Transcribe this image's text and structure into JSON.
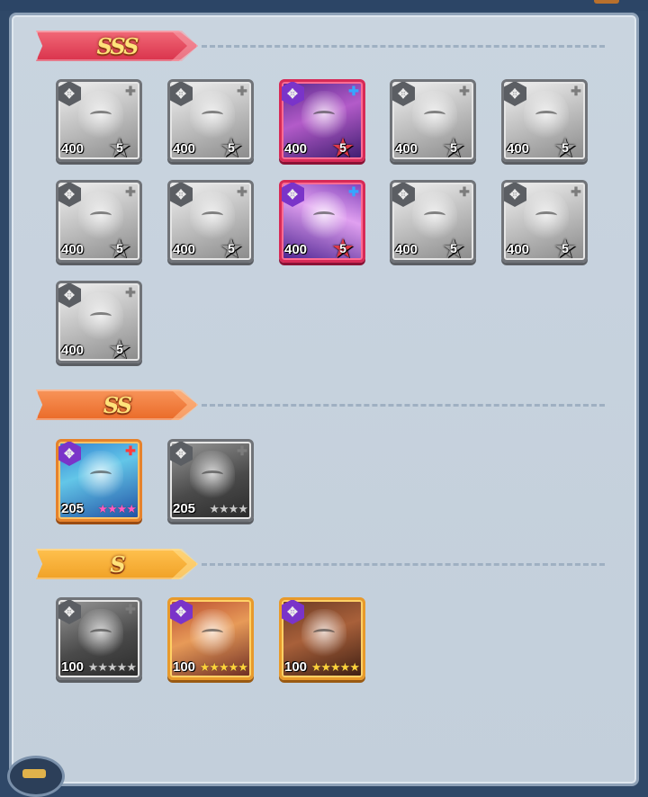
{
  "tiers": [
    {
      "label": "SSS",
      "ribbon_color": "#e6455c",
      "heroes": [
        {
          "level": "400",
          "stars": "5",
          "style": "gray",
          "faction": "gray",
          "plus": "gray"
        },
        {
          "level": "400",
          "stars": "5",
          "style": "gray",
          "faction": "gray",
          "plus": "gray"
        },
        {
          "level": "400",
          "stars": "5",
          "style": "pink",
          "faction": "purple",
          "plus": "blue"
        },
        {
          "level": "400",
          "stars": "5",
          "style": "gray",
          "faction": "gray",
          "plus": "gray"
        },
        {
          "level": "400",
          "stars": "5",
          "style": "gray",
          "faction": "gray",
          "plus": "gray"
        },
        {
          "level": "400",
          "stars": "5",
          "style": "gray",
          "faction": "gray",
          "plus": "gray"
        },
        {
          "level": "400",
          "stars": "5",
          "style": "gray",
          "faction": "gray",
          "plus": "gray"
        },
        {
          "level": "400",
          "stars": "5",
          "style": "pink2",
          "faction": "purple",
          "plus": "blue"
        },
        {
          "level": "400",
          "stars": "5",
          "style": "gray",
          "faction": "gray",
          "plus": "gray"
        },
        {
          "level": "400",
          "stars": "5",
          "style": "gray",
          "faction": "gray",
          "plus": "gray"
        },
        {
          "level": "400",
          "stars": "5",
          "style": "gray",
          "faction": "gray",
          "plus": "gray"
        }
      ]
    },
    {
      "label": "SS",
      "ribbon_color": "#f07a2e",
      "heroes": [
        {
          "level": "205",
          "star_row": "★★★★",
          "style": "orange",
          "faction": "purple",
          "plus": "red"
        },
        {
          "level": "205",
          "star_row": "★★★★",
          "style": "dark",
          "faction": "gray",
          "plus": "gray"
        }
      ]
    },
    {
      "label": "S",
      "ribbon_color": "#f3a934",
      "heroes": [
        {
          "level": "100",
          "star_row": "★★★★★",
          "style": "dark",
          "faction": "gray",
          "plus": "gray"
        },
        {
          "level": "100",
          "star_row": "★★★★★",
          "style": "orange2",
          "faction": "purple",
          "plus": "none"
        },
        {
          "level": "100",
          "star_row": "★★★★★",
          "style": "orange3",
          "faction": "purple",
          "plus": "none"
        }
      ]
    }
  ],
  "icons": {
    "faction_icon": "✥",
    "plus_icon": "✚",
    "star_icon": "★"
  }
}
